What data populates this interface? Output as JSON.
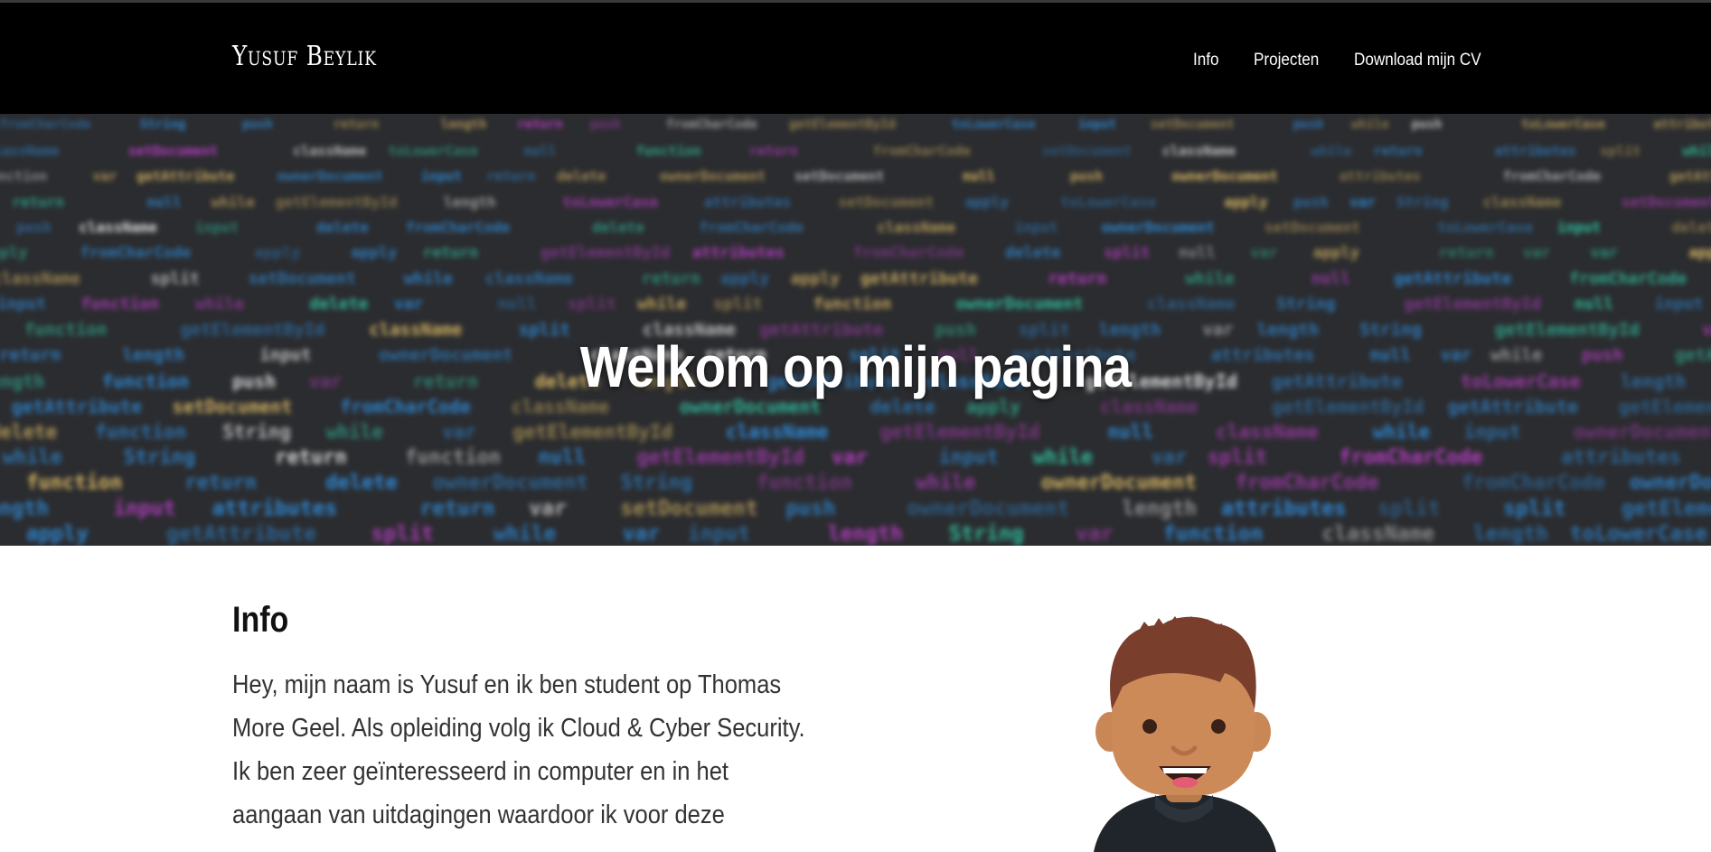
{
  "nav": {
    "brand": "Yusuf Beylik",
    "items": [
      {
        "label": "Info"
      },
      {
        "label": "Projecten"
      },
      {
        "label": "Download mijn CV"
      }
    ]
  },
  "hero": {
    "title": "Welkom op mijn pagina",
    "background_code_tokens": [
      "function",
      "return",
      "var",
      "length",
      "while",
      "split",
      "toLowerCase",
      "input",
      "push",
      "apply",
      "String",
      "fromCharCode",
      "delete",
      "null",
      "className",
      "getAttribute",
      "attributes",
      "setDocument",
      "ownerDocument",
      "getElementById"
    ]
  },
  "info": {
    "title": "Info",
    "lines": [
      "Hey, mijn naam is Yusuf en ik ben student op Thomas",
      "More Geel. Als opleiding volg ik Cloud & Cyber Security.",
      "Ik ben zeer geïnteresseerd in computer en in het",
      "aangaan van uitdagingen waardoor ik voor deze"
    ]
  },
  "colors": {
    "navbar_bg": "#000000",
    "hero_bg": "#2b2c2f",
    "code_blue": "#2f8fe0",
    "code_teal": "#2fc9a8",
    "code_yellow": "#e8c46a",
    "code_white": "#e8e8e8",
    "code_magenta": "#c33fd1"
  },
  "avatar": {
    "icon": "avatar-illustration"
  }
}
